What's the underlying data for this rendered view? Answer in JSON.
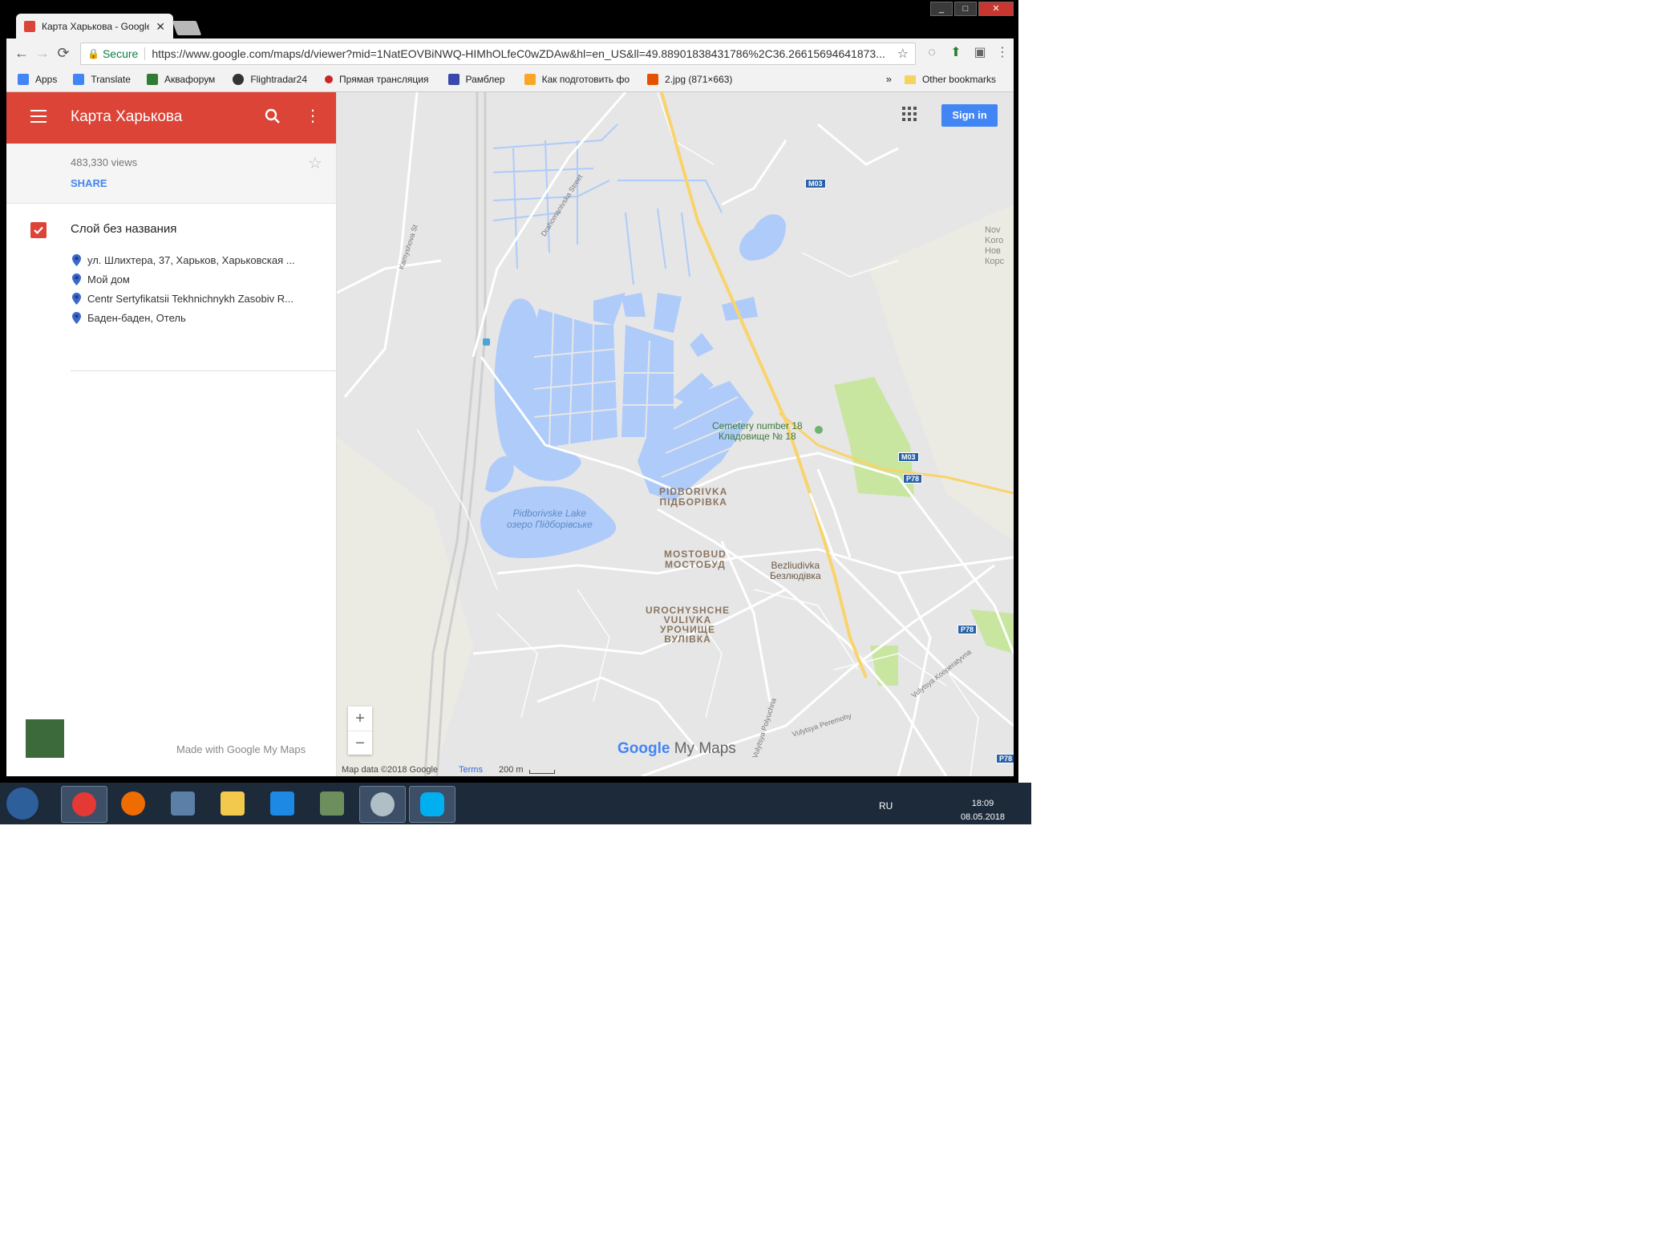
{
  "browser": {
    "tab_title": "Карта Харькова - Google",
    "tab_close": "✕",
    "secure_label": "Secure",
    "url": "https://www.google.com/maps/d/viewer?mid=1NatEOVBiNWQ-HIMhOLfeC0wZDAw&hl=en_US&ll=49.88901838431786%2C36.26615694641873...",
    "bookmarks": [
      {
        "label": "Apps",
        "icon": "apps-grid-icon",
        "color": "#4285f4"
      },
      {
        "label": "Translate",
        "icon": "translate-icon",
        "color": "#4285f4"
      },
      {
        "label": "Аквафорум",
        "icon": "aquaforum-icon",
        "color": "#2e7d32"
      },
      {
        "label": "Flightradar24",
        "icon": "flightradar-icon",
        "color": "#333333"
      },
      {
        "label": "Прямая трансляция",
        "icon": "live-icon",
        "color": "#c62828"
      },
      {
        "label": "Рамблер",
        "icon": "rambler-icon",
        "color": "#3949ab"
      },
      {
        "label": "Как подготовить фо",
        "icon": "photo-guide-icon",
        "color": "#f9a825"
      },
      {
        "label": "2.jpg (871×663)",
        "icon": "image-icon",
        "color": "#e65100"
      }
    ],
    "bookmarks_more": "»",
    "other_bookmarks": "Other bookmarks"
  },
  "sidebar": {
    "title": "Карта Харькова",
    "views": "483,330 views",
    "share": "SHARE",
    "layer_title": "Слой без названия",
    "places": [
      "ул. Шлихтера, 37, Харьков, Харьковская ...",
      "Мой дом",
      "Centr Sertyfikatsii Tekhnichnykh Zasobiv R...",
      "Баден-баден, Отель"
    ],
    "made_with": "Made with Google My Maps"
  },
  "map": {
    "signin": "Sign in",
    "zoom_in": "+",
    "zoom_out": "−",
    "labels": {
      "cemetery_en": "Cemetery number 18",
      "cemetery_uk": "Кладовище № 18",
      "pidborivka_en": "PIDBORIVKA",
      "pidborivka_uk": "ПІДБОРІВКА",
      "lake_en": "Pidborivske Lake",
      "lake_uk": "озеро Підборівське",
      "mostobud_en": "MOSTOBUD",
      "mostobud_uk": "МОСТОБУД",
      "bezliudivka_en": "Bezliudivka",
      "bezliudivka_uk": "Безлюдівка",
      "urochyshche_en1": "UROCHYSHCHE",
      "urochyshche_en2": "VULIVKA",
      "urochyshche_uk1": "УРОЧИЩЕ",
      "urochyshche_uk2": "ВУЛІВКА",
      "novi_korotych": "Nov Koro Нов Корс",
      "street_drahomanivska": "Drahomanivska Street",
      "street_kamyshova": "Kamyshova St",
      "street_kooperatyvna": "Vulytsya Kooperatyvna",
      "street_peremohy": "Vulytsya Peremohy",
      "street_poliovuchna": "Vulytsya Polyuchna"
    },
    "shields": [
      "M03",
      "M03",
      "P78",
      "P78",
      "P78"
    ],
    "attribution": {
      "map_data": "Map data ©2018 Google",
      "terms": "Terms",
      "scale": "200 m"
    },
    "logo_google": "Google",
    "logo_mymaps": " My Maps",
    "colors": {
      "water": "#aecbfa",
      "water_strong": "#9dc1f5",
      "park": "#c8e6a0",
      "land": "#e6e6e6",
      "road": "#ffffff",
      "highway": "#f9d36b",
      "brand_red": "#db4437",
      "brand_blue": "#4285f4"
    }
  },
  "taskbar": {
    "language": "RU",
    "time": "18:09",
    "date": "08.05.2018",
    "apps": [
      "chrome-icon",
      "firefox-icon",
      "computer-icon",
      "explorer-icon",
      "teamviewer-icon",
      "camera-icon",
      "paint-icon",
      "skype-icon"
    ]
  }
}
